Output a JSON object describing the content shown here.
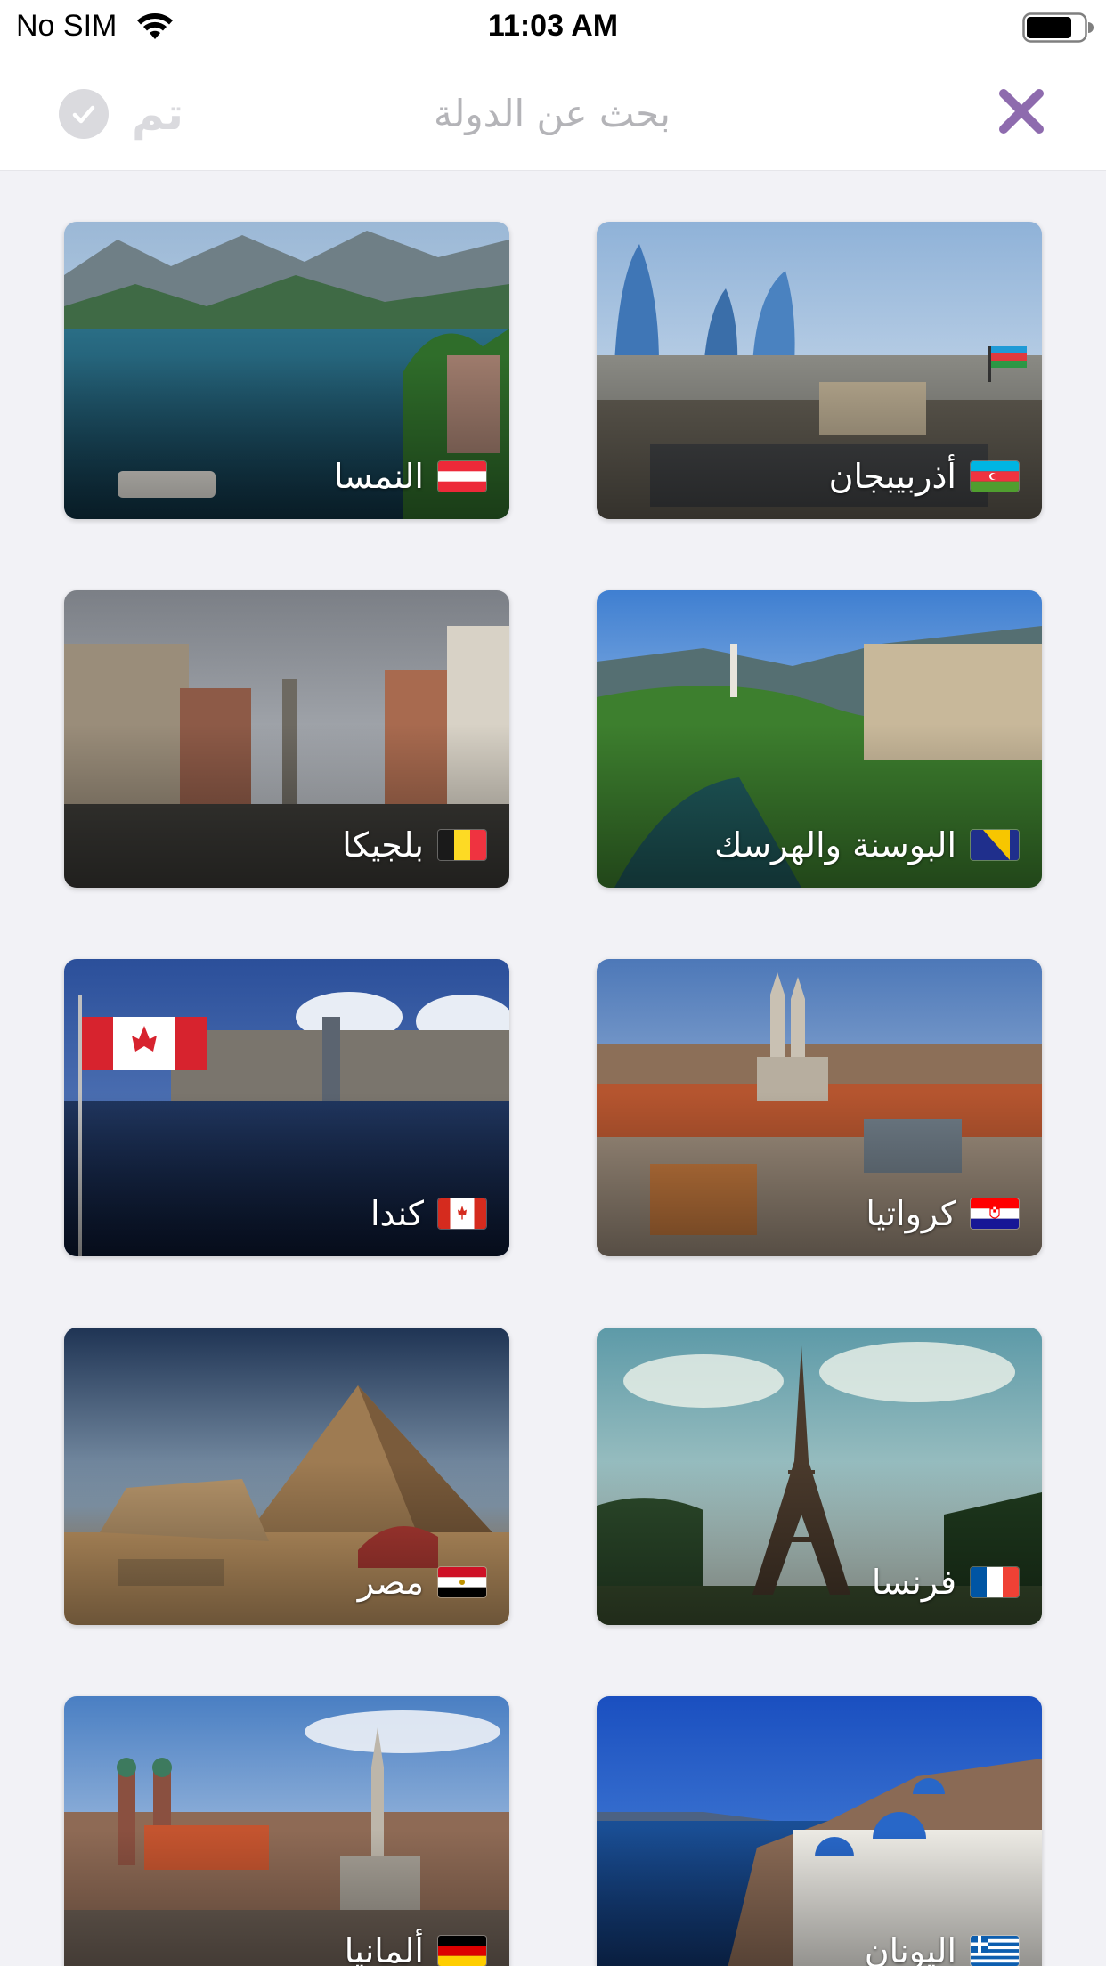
{
  "status_bar": {
    "carrier": "No SIM",
    "time": "11:03 AM"
  },
  "nav": {
    "done_label": "تم",
    "search_placeholder": "بحث عن الدولة",
    "accent_color": "#8e6bae",
    "disabled_color": "#dadade"
  },
  "countries": [
    {
      "name": "النمسا",
      "flag": "austria"
    },
    {
      "name": "أذربيبجان",
      "flag": "azerbaijan"
    },
    {
      "name": "بلجيكا",
      "flag": "belgium"
    },
    {
      "name": "البوسنة والهرسك",
      "flag": "bosnia"
    },
    {
      "name": "كندا",
      "flag": "canada"
    },
    {
      "name": "كرواتيا",
      "flag": "croatia"
    },
    {
      "name": "مصر",
      "flag": "egypt"
    },
    {
      "name": "فرنسا",
      "flag": "france"
    },
    {
      "name": "ألمانيا",
      "flag": "germany"
    },
    {
      "name": "اليونان",
      "flag": "greece"
    }
  ]
}
